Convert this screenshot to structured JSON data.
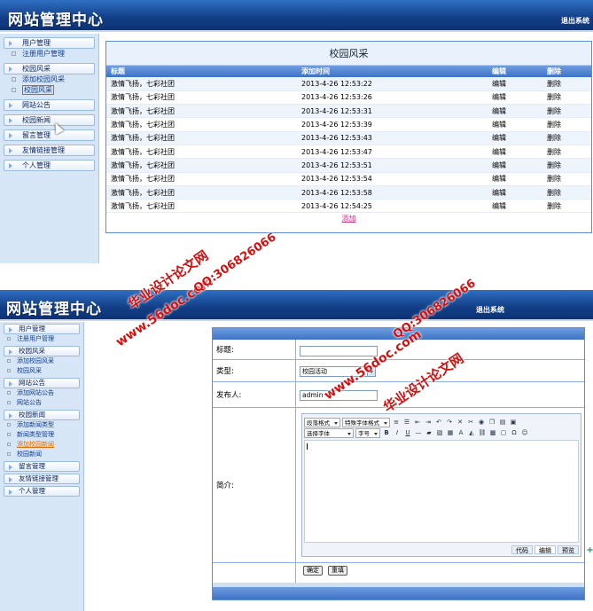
{
  "panel1": {
    "header": {
      "title": "网站管理中心",
      "logout": "退出系统"
    },
    "sidebar": [
      {
        "label": "用户管理",
        "items": [
          "注册用户管理"
        ]
      },
      {
        "label": "校园风采",
        "items": [
          "添加校园风采",
          "校园风采"
        ]
      },
      {
        "label": "网站公告",
        "items": []
      },
      {
        "label": "校园新闻",
        "items": []
      },
      {
        "label": "留言管理",
        "items": []
      },
      {
        "label": "友情链接管理",
        "items": []
      },
      {
        "label": "个人管理",
        "items": []
      }
    ],
    "table": {
      "title": "校园风采",
      "columns": [
        "标题",
        "添加时间",
        "编辑",
        "删除"
      ],
      "rows": [
        [
          "激情飞扬，七彩社团",
          "2013-4-26 12:53:22",
          "编辑",
          "删除"
        ],
        [
          "激情飞扬，七彩社团",
          "2013-4-26 12:53:26",
          "编辑",
          "删除"
        ],
        [
          "激情飞扬，七彩社团",
          "2013-4-26 12:53:31",
          "编辑",
          "删除"
        ],
        [
          "激情飞扬，七彩社团",
          "2013-4-26 12:53:39",
          "编辑",
          "删除"
        ],
        [
          "激情飞扬，七彩社团",
          "2013-4-26 12:53:43",
          "编辑",
          "删除"
        ],
        [
          "激情飞扬，七彩社团",
          "2013-4-26 12:53:47",
          "编辑",
          "删除"
        ],
        [
          "激情飞扬，七彩社团",
          "2013-4-26 12:53:51",
          "编辑",
          "删除"
        ],
        [
          "激情飞扬，七彩社团",
          "2013-4-26 12:53:54",
          "编辑",
          "删除"
        ],
        [
          "激情飞扬，七彩社团",
          "2013-4-26 12:53:58",
          "编辑",
          "删除"
        ],
        [
          "激情飞扬，七彩社团",
          "2013-4-26 12:54:25",
          "编辑",
          "删除"
        ]
      ],
      "add_link": "添加"
    }
  },
  "panel2": {
    "header": {
      "title": "网站管理中心",
      "logout": "退出系统"
    },
    "sidebar": [
      {
        "label": "用户管理",
        "items": [
          "注册用户管理"
        ]
      },
      {
        "label": "校园风采",
        "items": [
          "添加校园风采",
          "校园风采"
        ]
      },
      {
        "label": "网站公告",
        "items": [
          "添加网站公告",
          "网站公告"
        ]
      },
      {
        "label": "校园新闻",
        "items": [
          "添加新闻类型",
          "新闻类型管理",
          "添加校园新闻",
          "校园新闻"
        ]
      },
      {
        "label": "留言管理",
        "items": []
      },
      {
        "label": "友情链接管理",
        "items": []
      },
      {
        "label": "个人管理",
        "items": []
      }
    ],
    "form": {
      "title_label": "标题:",
      "title_value": "",
      "type_label": "类型:",
      "type_value": "校园活动",
      "author_label": "发布人:",
      "author_value": "admin",
      "intro_label": "简介:",
      "editor": {
        "row1_selects": [
          "段落格式",
          "特殊字体格式"
        ],
        "row2_selects": [
          "选择字体",
          "字号"
        ],
        "modes": [
          "代码",
          "编辑",
          "预览"
        ]
      },
      "submit": "确定",
      "reset": "重填"
    }
  },
  "watermarks": [
    "华业设计论文网",
    "www.56doc.com",
    "QQ:306826066"
  ],
  "colors": {
    "header": "#123e86",
    "sidebar": "#d6e6f6",
    "table_head": "#3e72c6",
    "watermark": "#d41010",
    "link": "#c0398a"
  }
}
